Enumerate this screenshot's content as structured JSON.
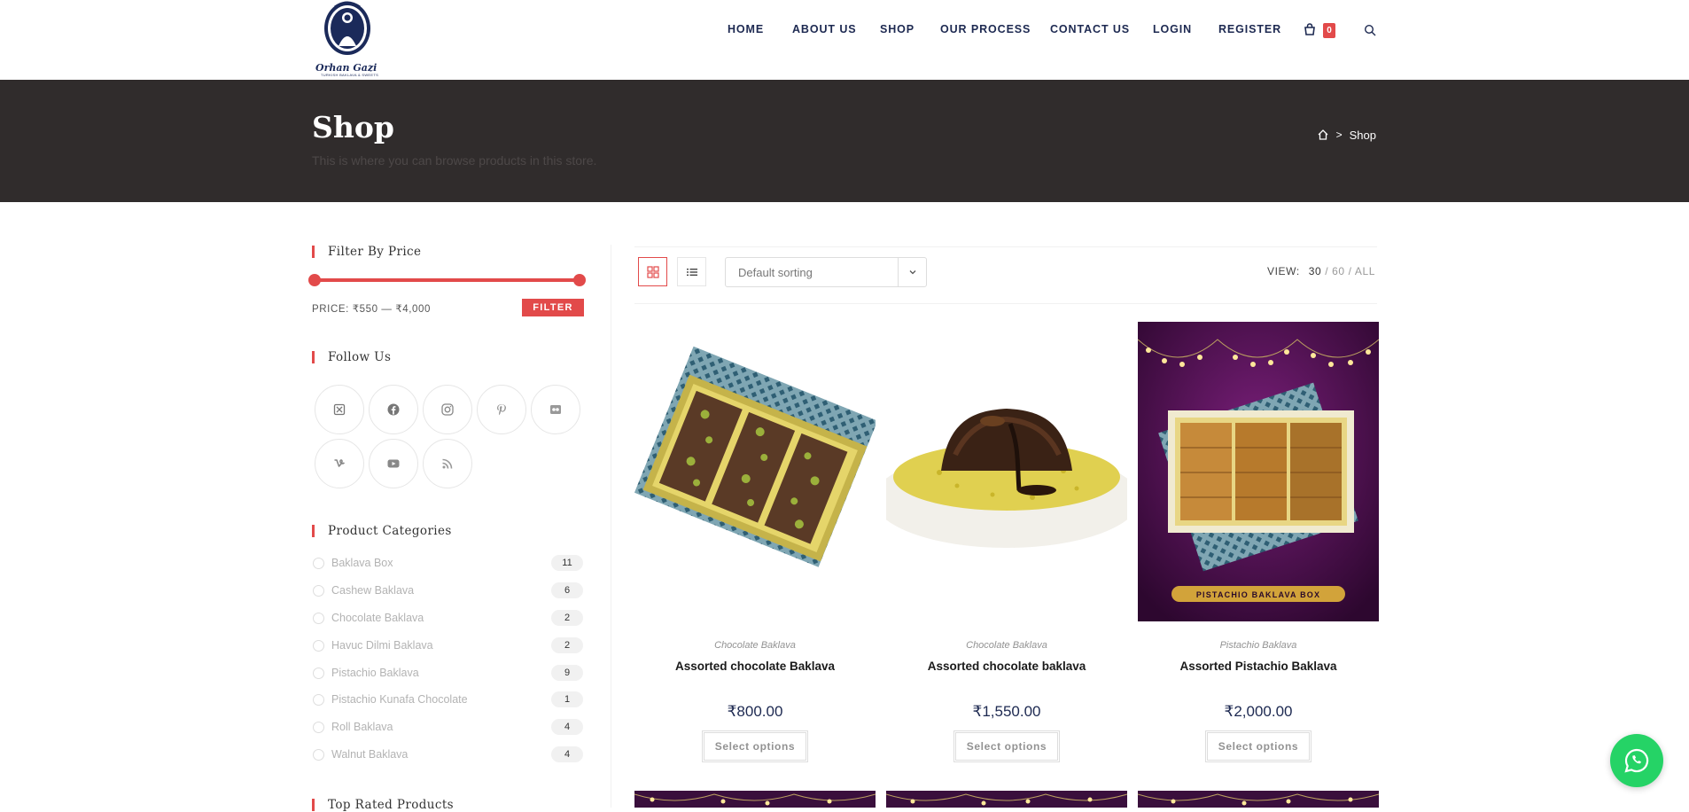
{
  "brand": {
    "logo_text": "Orhan Gazi",
    "logo_tagline": "TURKISH BAKLAVA & SWEETS"
  },
  "nav": {
    "items": [
      {
        "label": "HOME"
      },
      {
        "label": "ABOUT US"
      },
      {
        "label": "SHOP"
      },
      {
        "label": "OUR PROCESS"
      },
      {
        "label": "CONTACT US"
      },
      {
        "label": "LOGIN"
      },
      {
        "label": "REGISTER"
      }
    ],
    "cart_count": "0",
    "cart_icon": "cart-icon",
    "search_icon": "search-icon"
  },
  "page_header": {
    "title": "Shop",
    "subtitle": "This is where you can browse products in this store.",
    "breadcrumb_home_icon": "home-icon",
    "breadcrumb_separator": ">",
    "breadcrumb_current": "Shop"
  },
  "sidebar": {
    "filter": {
      "title": "Filter By Price",
      "price_text": "PRICE: ₹550 — ₹4,000",
      "button": "FILTER",
      "min_fraction": 0.0,
      "max_fraction": 1.0
    },
    "follow": {
      "title": "Follow Us",
      "icons": [
        "x-icon",
        "facebook-icon",
        "instagram-icon",
        "pinterest-icon",
        "flickr-icon",
        "vine-icon",
        "youtube-icon",
        "rss-icon"
      ]
    },
    "categories": {
      "title": "Product Categories",
      "items": [
        {
          "name": "Baklava Box",
          "count": "11"
        },
        {
          "name": "Cashew Baklava",
          "count": "6"
        },
        {
          "name": "Chocolate Baklava",
          "count": "2"
        },
        {
          "name": "Havuc Dilmi Baklava",
          "count": "2"
        },
        {
          "name": "Pistachio Baklava",
          "count": "9"
        },
        {
          "name": "Pistachio Kunafa Chocolate",
          "count": "1"
        },
        {
          "name": "Roll Baklava",
          "count": "4"
        },
        {
          "name": "Walnut Baklava",
          "count": "4"
        }
      ]
    },
    "top_rated": {
      "title": "Top Rated Products"
    }
  },
  "toolbar": {
    "grid_icon": "grid-view-icon",
    "list_icon": "list-view-icon",
    "sort_value": "Default sorting",
    "view_label": "VIEW:",
    "view_options": [
      "30",
      "60",
      "ALL"
    ],
    "view_active": "30"
  },
  "products": [
    {
      "category": "Chocolate Baklava",
      "title": "Assorted chocolate Baklava",
      "price": "₹800.00",
      "button": "Select options"
    },
    {
      "category": "Chocolate Baklava",
      "title": "Assorted chocolate baklava",
      "price": "₹1,550.00",
      "button": "Select options"
    },
    {
      "category": "Pistachio Baklava",
      "title": "Assorted Pistachio Baklava",
      "price": "₹2,000.00",
      "button": "Select options",
      "image_label": "PISTACHIO BAKLAVA BOX"
    }
  ],
  "whatsapp_icon": "whatsapp-icon",
  "colors": {
    "accent": "#e24a4a",
    "nav_text": "#1d2951",
    "header_band": "#302c2c"
  }
}
